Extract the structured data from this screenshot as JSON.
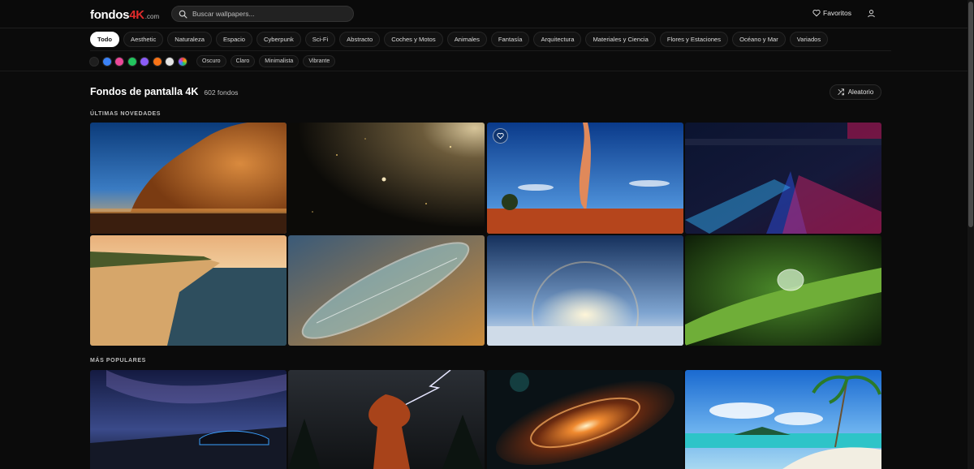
{
  "header": {
    "logo": {
      "part1": "fondos",
      "part2": "4K",
      "part3": ".com"
    },
    "search": {
      "placeholder": "Buscar wallpapers...",
      "value": ""
    },
    "favorites_label": "Favoritos",
    "icons": {
      "search": "search-icon",
      "favorites": "heart-icon",
      "user": "user-icon"
    }
  },
  "categories": [
    {
      "label": "Todo",
      "active": true
    },
    {
      "label": "Aesthetic"
    },
    {
      "label": "Naturaleza"
    },
    {
      "label": "Espacio"
    },
    {
      "label": "Cyberpunk"
    },
    {
      "label": "Sci-Fi"
    },
    {
      "label": "Abstracto"
    },
    {
      "label": "Coches y Motos"
    },
    {
      "label": "Animales"
    },
    {
      "label": "Fantasía"
    },
    {
      "label": "Arquitectura"
    },
    {
      "label": "Materiales y Ciencia"
    },
    {
      "label": "Flores y Estaciones"
    },
    {
      "label": "Océano y Mar"
    },
    {
      "label": "Variados"
    }
  ],
  "color_filters": [
    "#1e1e1e",
    "#3b82f6",
    "#ec4899",
    "#22c55e",
    "#8b5cf6",
    "#f97316",
    "#e5e5e5",
    "multicolor"
  ],
  "tone_filters": [
    {
      "label": "Oscuro"
    },
    {
      "label": "Claro"
    },
    {
      "label": "Minimalista"
    },
    {
      "label": "Vibrante"
    }
  ],
  "main": {
    "title": "Fondos de pantalla 4K",
    "count": "602 fondos",
    "random_label": "Aleatorio"
  },
  "sections": {
    "latest": {
      "label": "ÚLTIMAS NOVEDADES",
      "items": [
        {
          "subject": "dust-storm-desert"
        },
        {
          "subject": "golden-particles-space"
        },
        {
          "subject": "fire-tornado-outback",
          "favorite_button": true
        },
        {
          "subject": "cyberpunk-city-traffic"
        },
        {
          "subject": "white-cliffs-sunset"
        },
        {
          "subject": "diatom-microscope"
        },
        {
          "subject": "sun-halo-ice"
        },
        {
          "subject": "water-drop-fern"
        }
      ]
    },
    "popular": {
      "label": "MÁS POPULARES",
      "items": [
        {
          "subject": "milky-way-supercar"
        },
        {
          "subject": "lightning-sequoia-tree"
        },
        {
          "subject": "spiral-galaxy"
        },
        {
          "subject": "tropical-beach-palms"
        }
      ]
    }
  }
}
